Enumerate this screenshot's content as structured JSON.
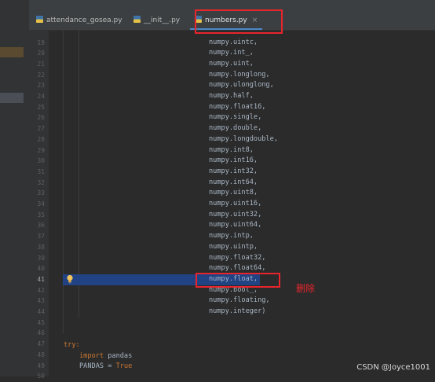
{
  "tabs": [
    {
      "label": "attendance_gosea.py",
      "active": false,
      "icon": "python-file-icon"
    },
    {
      "label": "__init__.py",
      "active": false,
      "icon": "python-file-icon"
    },
    {
      "label": "numbers.py",
      "active": true,
      "icon": "python-file-icon",
      "close": "×"
    }
  ],
  "editor": {
    "line_numbers": [
      "19",
      "20",
      "21",
      "22",
      "23",
      "24",
      "25",
      "26",
      "27",
      "28",
      "29",
      "30",
      "31",
      "32",
      "33",
      "34",
      "35",
      "36",
      "37",
      "38",
      "39",
      "40",
      "41",
      "42",
      "43",
      "44",
      "45",
      "46",
      "47",
      "48",
      "49",
      "50"
    ],
    "current_line": "41",
    "lines": [
      "numpy.uintc,",
      "numpy.int_,",
      "numpy.uint,",
      "numpy.longlong,",
      "numpy.ulonglong,",
      "numpy.half,",
      "numpy.float16,",
      "numpy.single,",
      "numpy.double,",
      "numpy.longdouble,",
      "numpy.int8,",
      "numpy.int16,",
      "numpy.int32,",
      "numpy.int64,",
      "numpy.uint8,",
      "numpy.uint16,",
      "numpy.uint32,",
      "numpy.uint64,",
      "numpy.intp,",
      "numpy.uintp,",
      "numpy.float32,",
      "numpy.float64,",
      "numpy.float,",
      "numpy.bool_,",
      "numpy.floating,",
      "numpy.integer)"
    ],
    "try_kw": "try:",
    "import_kw": "import",
    "import_mod": " pandas",
    "pandas_assign": "PANDAS = ",
    "true_kw": "True"
  },
  "annotation": "删除",
  "watermark": "CSDN @Joyce1001",
  "colors": {
    "highlight": "#214283",
    "red_box": "#e8252d",
    "keyword": "#cc7832",
    "text": "#a9b7c6"
  }
}
